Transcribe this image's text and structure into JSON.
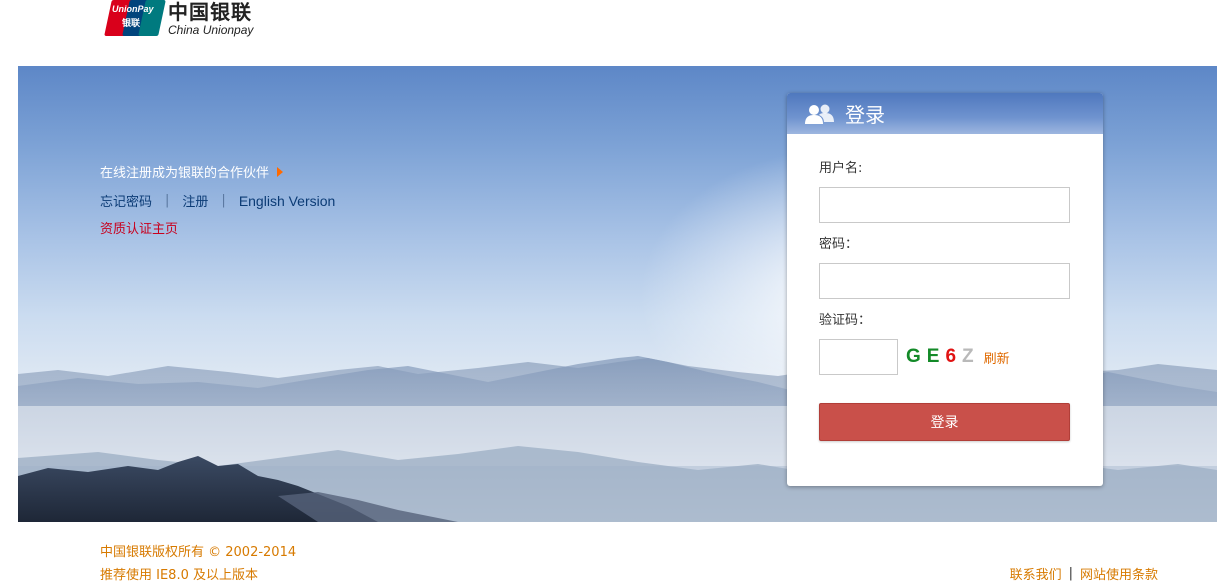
{
  "header": {
    "logo_badge_en": "UnionPay",
    "logo_badge_cn": "银联",
    "logo_cn": "中国银联",
    "logo_en": "China Unionpay"
  },
  "hero": {
    "register_partner": "在线注册成为银联的合作伙伴",
    "forgot_password": "忘记密码",
    "separator": "|",
    "register": "注册",
    "english_version": "English Version",
    "certification_home": "资质认证主页"
  },
  "login": {
    "title": "登录",
    "username_label": "用户名:",
    "username_value": "",
    "password_label": "密码：",
    "password_value": "",
    "captcha_label": "验证码：",
    "captcha_value": "",
    "captcha_chars": [
      "G",
      "E",
      "6",
      "Z"
    ],
    "refresh": "刷新",
    "submit": "登录"
  },
  "footer": {
    "copyright": "中国银联版权所有 © 2002-2014",
    "browser_note": "推荐使用 IE8.0 及以上版本",
    "contact_us": "联系我们",
    "separator": "|",
    "terms": "网站使用条款"
  },
  "colors": {
    "accent_orange": "#d77a00",
    "login_button": "#c9504a",
    "header_blue": "#4f78be",
    "link_red": "#c8001e"
  },
  "icons": {
    "login_header": "users-icon",
    "register_arrow": "triangle-right-icon"
  }
}
